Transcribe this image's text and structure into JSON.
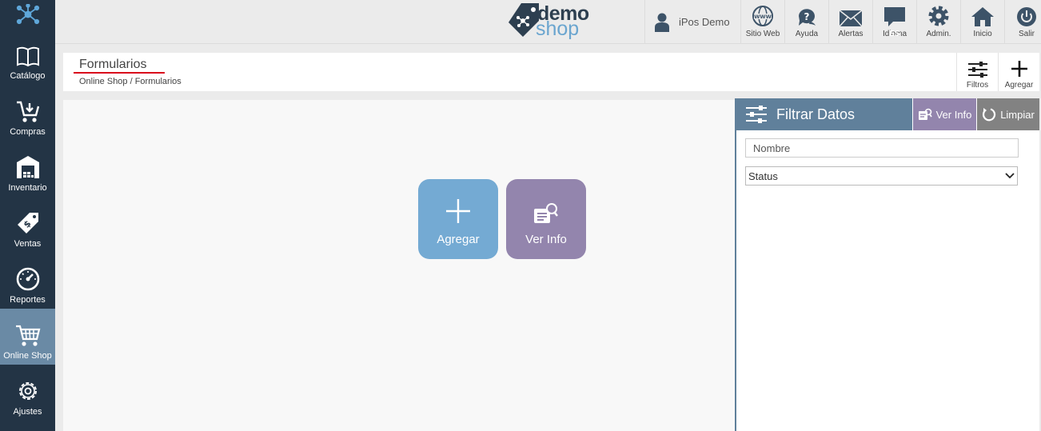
{
  "sidebar": {
    "items": [
      {
        "label": "Catálogo",
        "icon": "book-icon"
      },
      {
        "label": "Compras",
        "icon": "cart-add-icon"
      },
      {
        "label": "Inventario",
        "icon": "warehouse-icon"
      },
      {
        "label": "Ventas",
        "icon": "price-tag-icon"
      },
      {
        "label": "Reportes",
        "icon": "gauge-icon"
      },
      {
        "label": "Online Shop",
        "icon": "shopping-cart-icon"
      },
      {
        "label": "Ajustes",
        "icon": "gear-icon"
      }
    ],
    "active": "Online Shop"
  },
  "topbar": {
    "logo": {
      "line1": "demo",
      "line2": "shop"
    },
    "user": "iPos Demo",
    "buttons": [
      {
        "label": "Sitio Web",
        "icon": "globe-icon"
      },
      {
        "label": "Ayuda",
        "icon": "help-chat-icon"
      },
      {
        "label": "Alertas",
        "icon": "envelope-icon"
      },
      {
        "label": "Idioma",
        "icon": "language-icon",
        "badge": "ES"
      },
      {
        "label": "Admin.",
        "icon": "gear-icon"
      },
      {
        "label": "Inicio",
        "icon": "home-icon"
      },
      {
        "label": "Salir",
        "icon": "power-icon"
      }
    ]
  },
  "header": {
    "title": "Formularios",
    "breadcrumb": "Online Shop / Formularios",
    "filters_label": "Filtros",
    "add_label": "Agregar"
  },
  "main": {
    "tiles": [
      {
        "label": "Agregar",
        "icon": "plus-icon"
      },
      {
        "label": "Ver Info",
        "icon": "info-card-icon"
      }
    ]
  },
  "filter_panel": {
    "title": "Filtrar Datos",
    "ver_info_label": "Ver Info",
    "limpiar_label": "Limpiar",
    "name_placeholder": "Nombre",
    "status_value": "Status"
  },
  "colors": {
    "sidebar_bg": "#233445",
    "sidebar_active": "#6a8aa5",
    "tile_add": "#74aad3",
    "tile_info": "#9385ad",
    "filter_header": "#60809b",
    "limpiar": "#828282",
    "title_underline": "#d9001b"
  }
}
